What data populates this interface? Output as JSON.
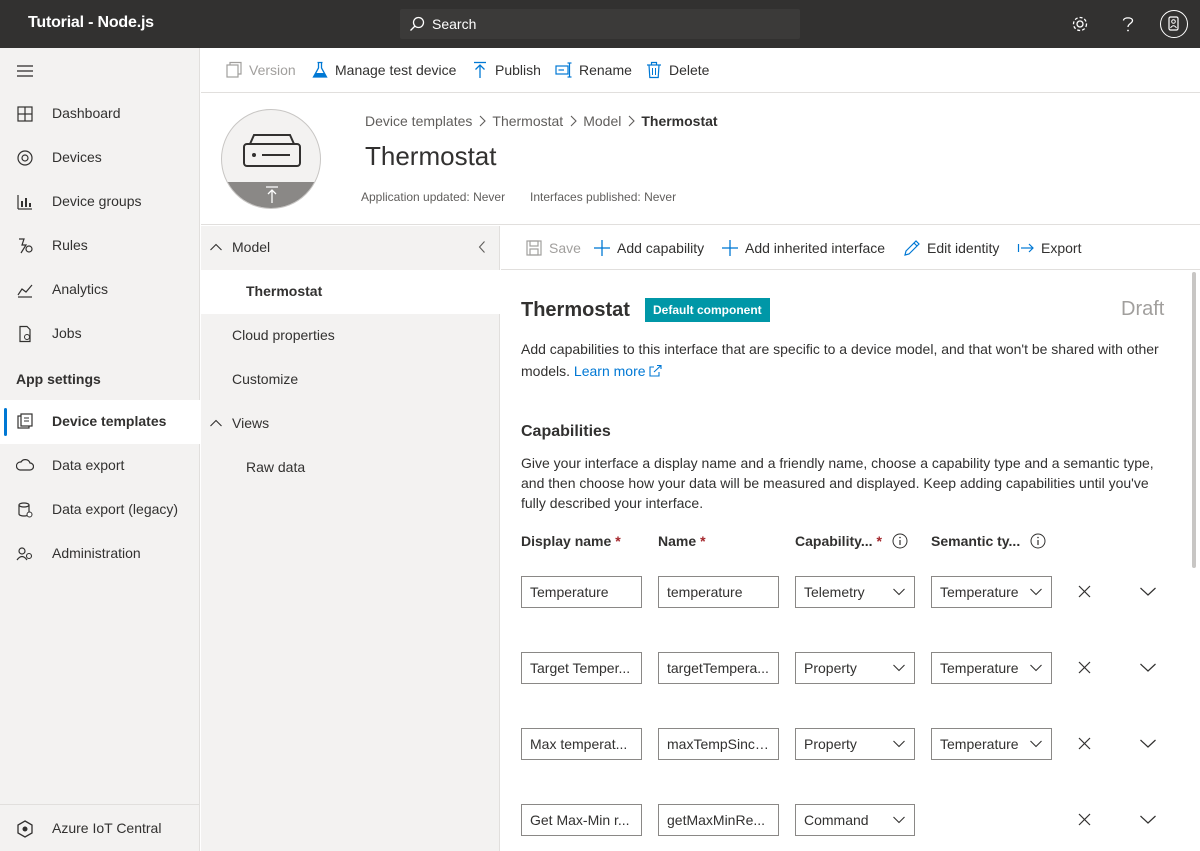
{
  "app": {
    "title": "Tutorial - Node.js"
  },
  "search": {
    "label": "Search"
  },
  "nav": {
    "items": [
      {
        "label": "Dashboard",
        "icon": "dashboard-icon"
      },
      {
        "label": "Devices",
        "icon": "devices-icon"
      },
      {
        "label": "Device groups",
        "icon": "device-groups-icon"
      },
      {
        "label": "Rules",
        "icon": "rules-icon"
      },
      {
        "label": "Analytics",
        "icon": "analytics-icon"
      },
      {
        "label": "Jobs",
        "icon": "jobs-icon"
      }
    ],
    "section": "App settings",
    "settings_items": [
      {
        "label": "Device templates",
        "icon": "device-templates-icon",
        "active": true
      },
      {
        "label": "Data export",
        "icon": "data-export-icon"
      },
      {
        "label": "Data export (legacy)",
        "icon": "data-export-legacy-icon"
      },
      {
        "label": "Administration",
        "icon": "administration-icon"
      }
    ],
    "footer": "Azure IoT Central"
  },
  "toolbar": {
    "version": "Version",
    "manage_test_device": "Manage test device",
    "publish": "Publish",
    "rename": "Rename",
    "delete": "Delete"
  },
  "header": {
    "breadcrumb": [
      "Device templates",
      "Thermostat",
      "Model",
      "Thermostat"
    ],
    "title": "Thermostat",
    "app_updated": "Application updated: Never",
    "interfaces_published": "Interfaces published: Never"
  },
  "tree": {
    "items": [
      {
        "label": "Model",
        "level": 0,
        "expandable": true
      },
      {
        "label": "Thermostat",
        "level": 1,
        "selected": true
      },
      {
        "label": "Cloud properties",
        "level": 0
      },
      {
        "label": "Customize",
        "level": 0
      },
      {
        "label": "Views",
        "level": 0,
        "expandable": true
      },
      {
        "label": "Raw data",
        "level": 1
      }
    ]
  },
  "editor_toolbar": {
    "save": "Save",
    "add_capability": "Add capability",
    "add_inherited_interface": "Add inherited interface",
    "edit_identity": "Edit identity",
    "export": "Export"
  },
  "interface": {
    "title": "Thermostat",
    "badge": "Default component",
    "status": "Draft",
    "description": "Add capabilities to this interface that are specific to a device model, and that won't be shared with other models.",
    "learn_more": "Learn more"
  },
  "capabilities": {
    "heading": "Capabilities",
    "description": "Give your interface a display name and a friendly name, choose a capability type and a semantic type, and then choose how your data will be measured and displayed. Keep adding capabilities until you've fully described your interface.",
    "columns": {
      "display_name": "Display name",
      "name": "Name",
      "capability": "Capability...",
      "semantic": "Semantic ty..."
    },
    "required_mark": "*",
    "rows": [
      {
        "display_name": "Temperature",
        "name": "temperature",
        "capability": "Telemetry",
        "semantic": "Temperature"
      },
      {
        "display_name": "Target Temper...",
        "name": "targetTempera...",
        "capability": "Property",
        "semantic": "Temperature"
      },
      {
        "display_name": "Max temperat...",
        "name": "maxTempSince...",
        "capability": "Property",
        "semantic": "Temperature"
      },
      {
        "display_name": "Get Max-Min r...",
        "name": "getMaxMinRe...",
        "capability": "Command",
        "semantic": ""
      }
    ]
  },
  "colors": {
    "topbar": "#323130",
    "accent": "#0078d4",
    "badge": "#0097a7",
    "nav_bg": "#f3f2f1"
  }
}
